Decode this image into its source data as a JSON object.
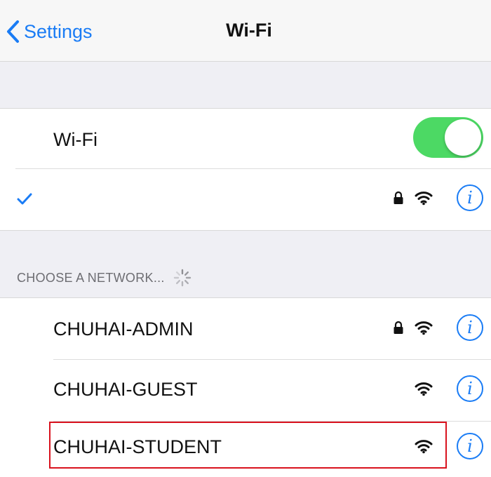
{
  "navbar": {
    "back_label": "Settings",
    "title": "Wi-Fi",
    "back_icon": "chevron-left-icon"
  },
  "wifi_toggle": {
    "label": "Wi-Fi",
    "on": true,
    "color": "#4cd964"
  },
  "connected_network": {
    "name": "",
    "checked": true,
    "secured": true
  },
  "section": {
    "header": "CHOOSE A NETWORK...",
    "loading": true
  },
  "networks": [
    {
      "name": "CHUHAI-ADMIN",
      "secured": true,
      "highlighted": false
    },
    {
      "name": "CHUHAI-GUEST",
      "secured": false,
      "highlighted": false
    },
    {
      "name": "CHUHAI-STUDENT",
      "secured": false,
      "highlighted": true
    }
  ],
  "info_symbol": "i",
  "colors": {
    "accent": "#1a7cf5",
    "toggle_on": "#4cd964",
    "highlight": "#d9121e",
    "group_background": "#efeff4"
  }
}
